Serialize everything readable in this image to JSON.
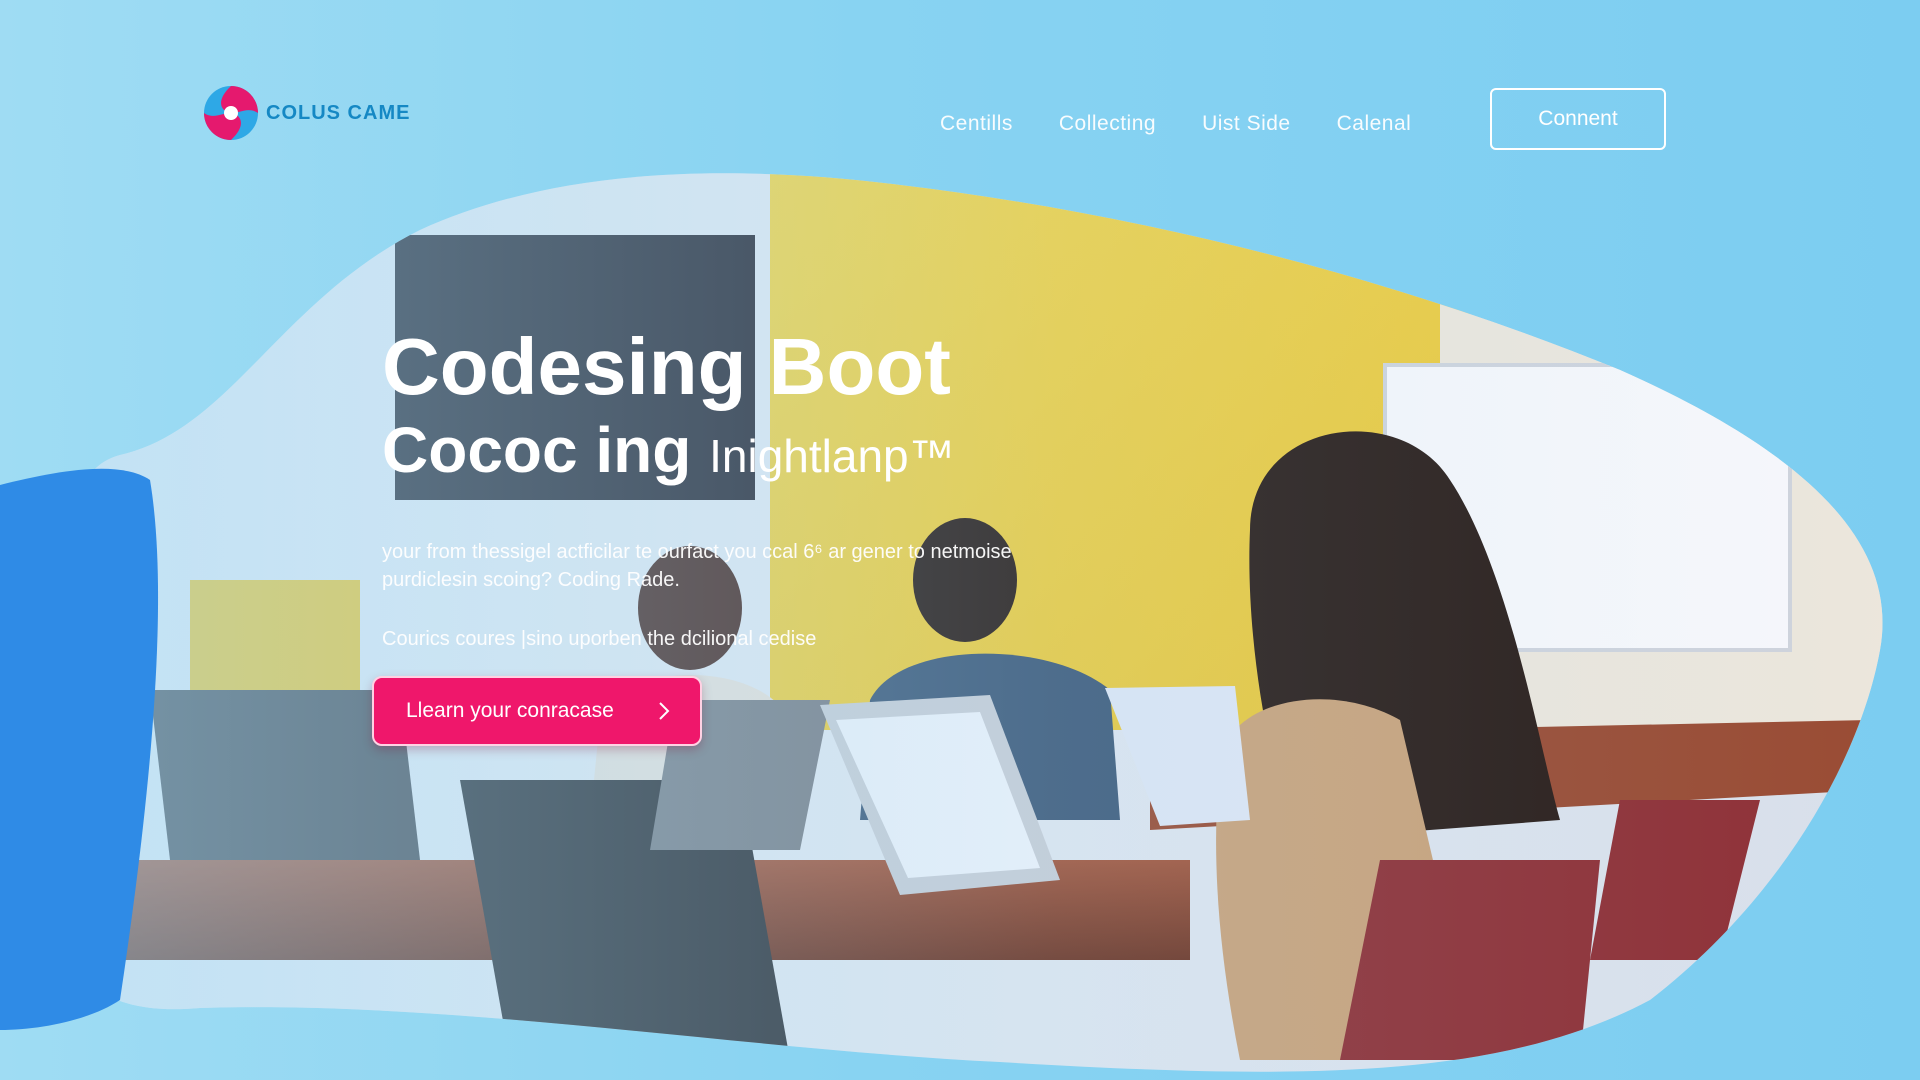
{
  "brand": {
    "name": "COLUS CAME",
    "icon": "swirl-logo-icon"
  },
  "nav": {
    "items": [
      {
        "label": "Centills"
      },
      {
        "label": "Collecting"
      },
      {
        "label": "Uist Side"
      },
      {
        "label": "Calenal"
      }
    ],
    "connect_label": "Connent"
  },
  "hero": {
    "title_line1": "Codesing Boot",
    "title_line2_bold": "Cococ ing",
    "title_line2_light": "Inightlanp™",
    "description": "your from thessigel actficilar te ourfact you ccal 6⁶ ar gener to netmoise purdiclesin scoing? Coding Rade.",
    "subtext": "Courics coures |sino uporben the dcilional cedise",
    "cta_label": "Llearn your conracase",
    "cta_icon": "chevron-right-icon",
    "photo_icon": "classroom-photo"
  },
  "colors": {
    "background": "#88d3f2",
    "blob_blue": "#2f8be6",
    "accent_pink": "#ef176b",
    "brand_blue": "#1588c4",
    "wall_yellow": "#f1d13a"
  }
}
